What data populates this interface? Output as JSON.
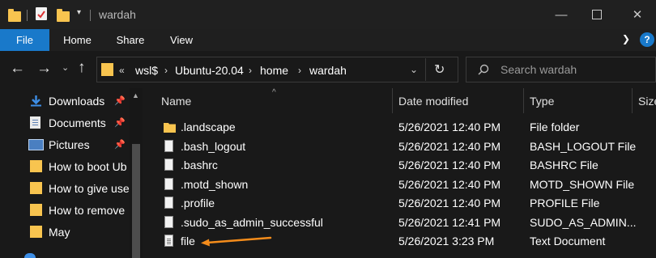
{
  "window": {
    "title": "wardah",
    "controls": {
      "minimize": "minimize-icon",
      "maximize": "maximize-icon",
      "close": "close-icon"
    }
  },
  "ribbon": {
    "tabs": [
      "File",
      "Home",
      "Share",
      "View"
    ],
    "help_icon": "help-icon"
  },
  "address": {
    "overflow": "«",
    "breadcrumbs": [
      "wsl$",
      "Ubuntu-20.04",
      "home",
      "wardah"
    ],
    "search_placeholder": "Search wardah"
  },
  "nav": {
    "items": [
      {
        "label": "Downloads",
        "icon": "download-icon",
        "pinned": true
      },
      {
        "label": "Documents",
        "icon": "documents-icon",
        "pinned": true
      },
      {
        "label": "Pictures",
        "icon": "pictures-icon",
        "pinned": true
      },
      {
        "label": "How to boot Ub",
        "icon": "folder-icon",
        "pinned": false
      },
      {
        "label": "How to give use",
        "icon": "folder-icon",
        "pinned": false
      },
      {
        "label": "How to remove",
        "icon": "folder-icon",
        "pinned": false
      },
      {
        "label": "May",
        "icon": "folder-icon",
        "pinned": false
      }
    ]
  },
  "columns": [
    "Name",
    "Date modified",
    "Type",
    "Size"
  ],
  "files": [
    {
      "name": ".landscape",
      "date": "5/26/2021 12:40 PM",
      "type": "File folder",
      "icon": "folder-icon"
    },
    {
      "name": ".bash_logout",
      "date": "5/26/2021 12:40 PM",
      "type": "BASH_LOGOUT File",
      "icon": "file-icon"
    },
    {
      "name": ".bashrc",
      "date": "5/26/2021 12:40 PM",
      "type": "BASHRC File",
      "icon": "file-icon"
    },
    {
      "name": ".motd_shown",
      "date": "5/26/2021 12:40 PM",
      "type": "MOTD_SHOWN File",
      "icon": "file-icon"
    },
    {
      "name": ".profile",
      "date": "5/26/2021 12:40 PM",
      "type": "PROFILE File",
      "icon": "file-icon"
    },
    {
      "name": ".sudo_as_admin_successful",
      "date": "5/26/2021 12:41 PM",
      "type": "SUDO_AS_ADMIN...",
      "icon": "file-icon"
    },
    {
      "name": "file",
      "date": "5/26/2021 3:23 PM",
      "type": "Text Document",
      "icon": "text-file-icon"
    }
  ],
  "annotation": {
    "color": "#f48c1b",
    "target": "file"
  },
  "colors": {
    "accent": "#1979ca",
    "folder": "#f8c44f",
    "background": "#191919"
  }
}
